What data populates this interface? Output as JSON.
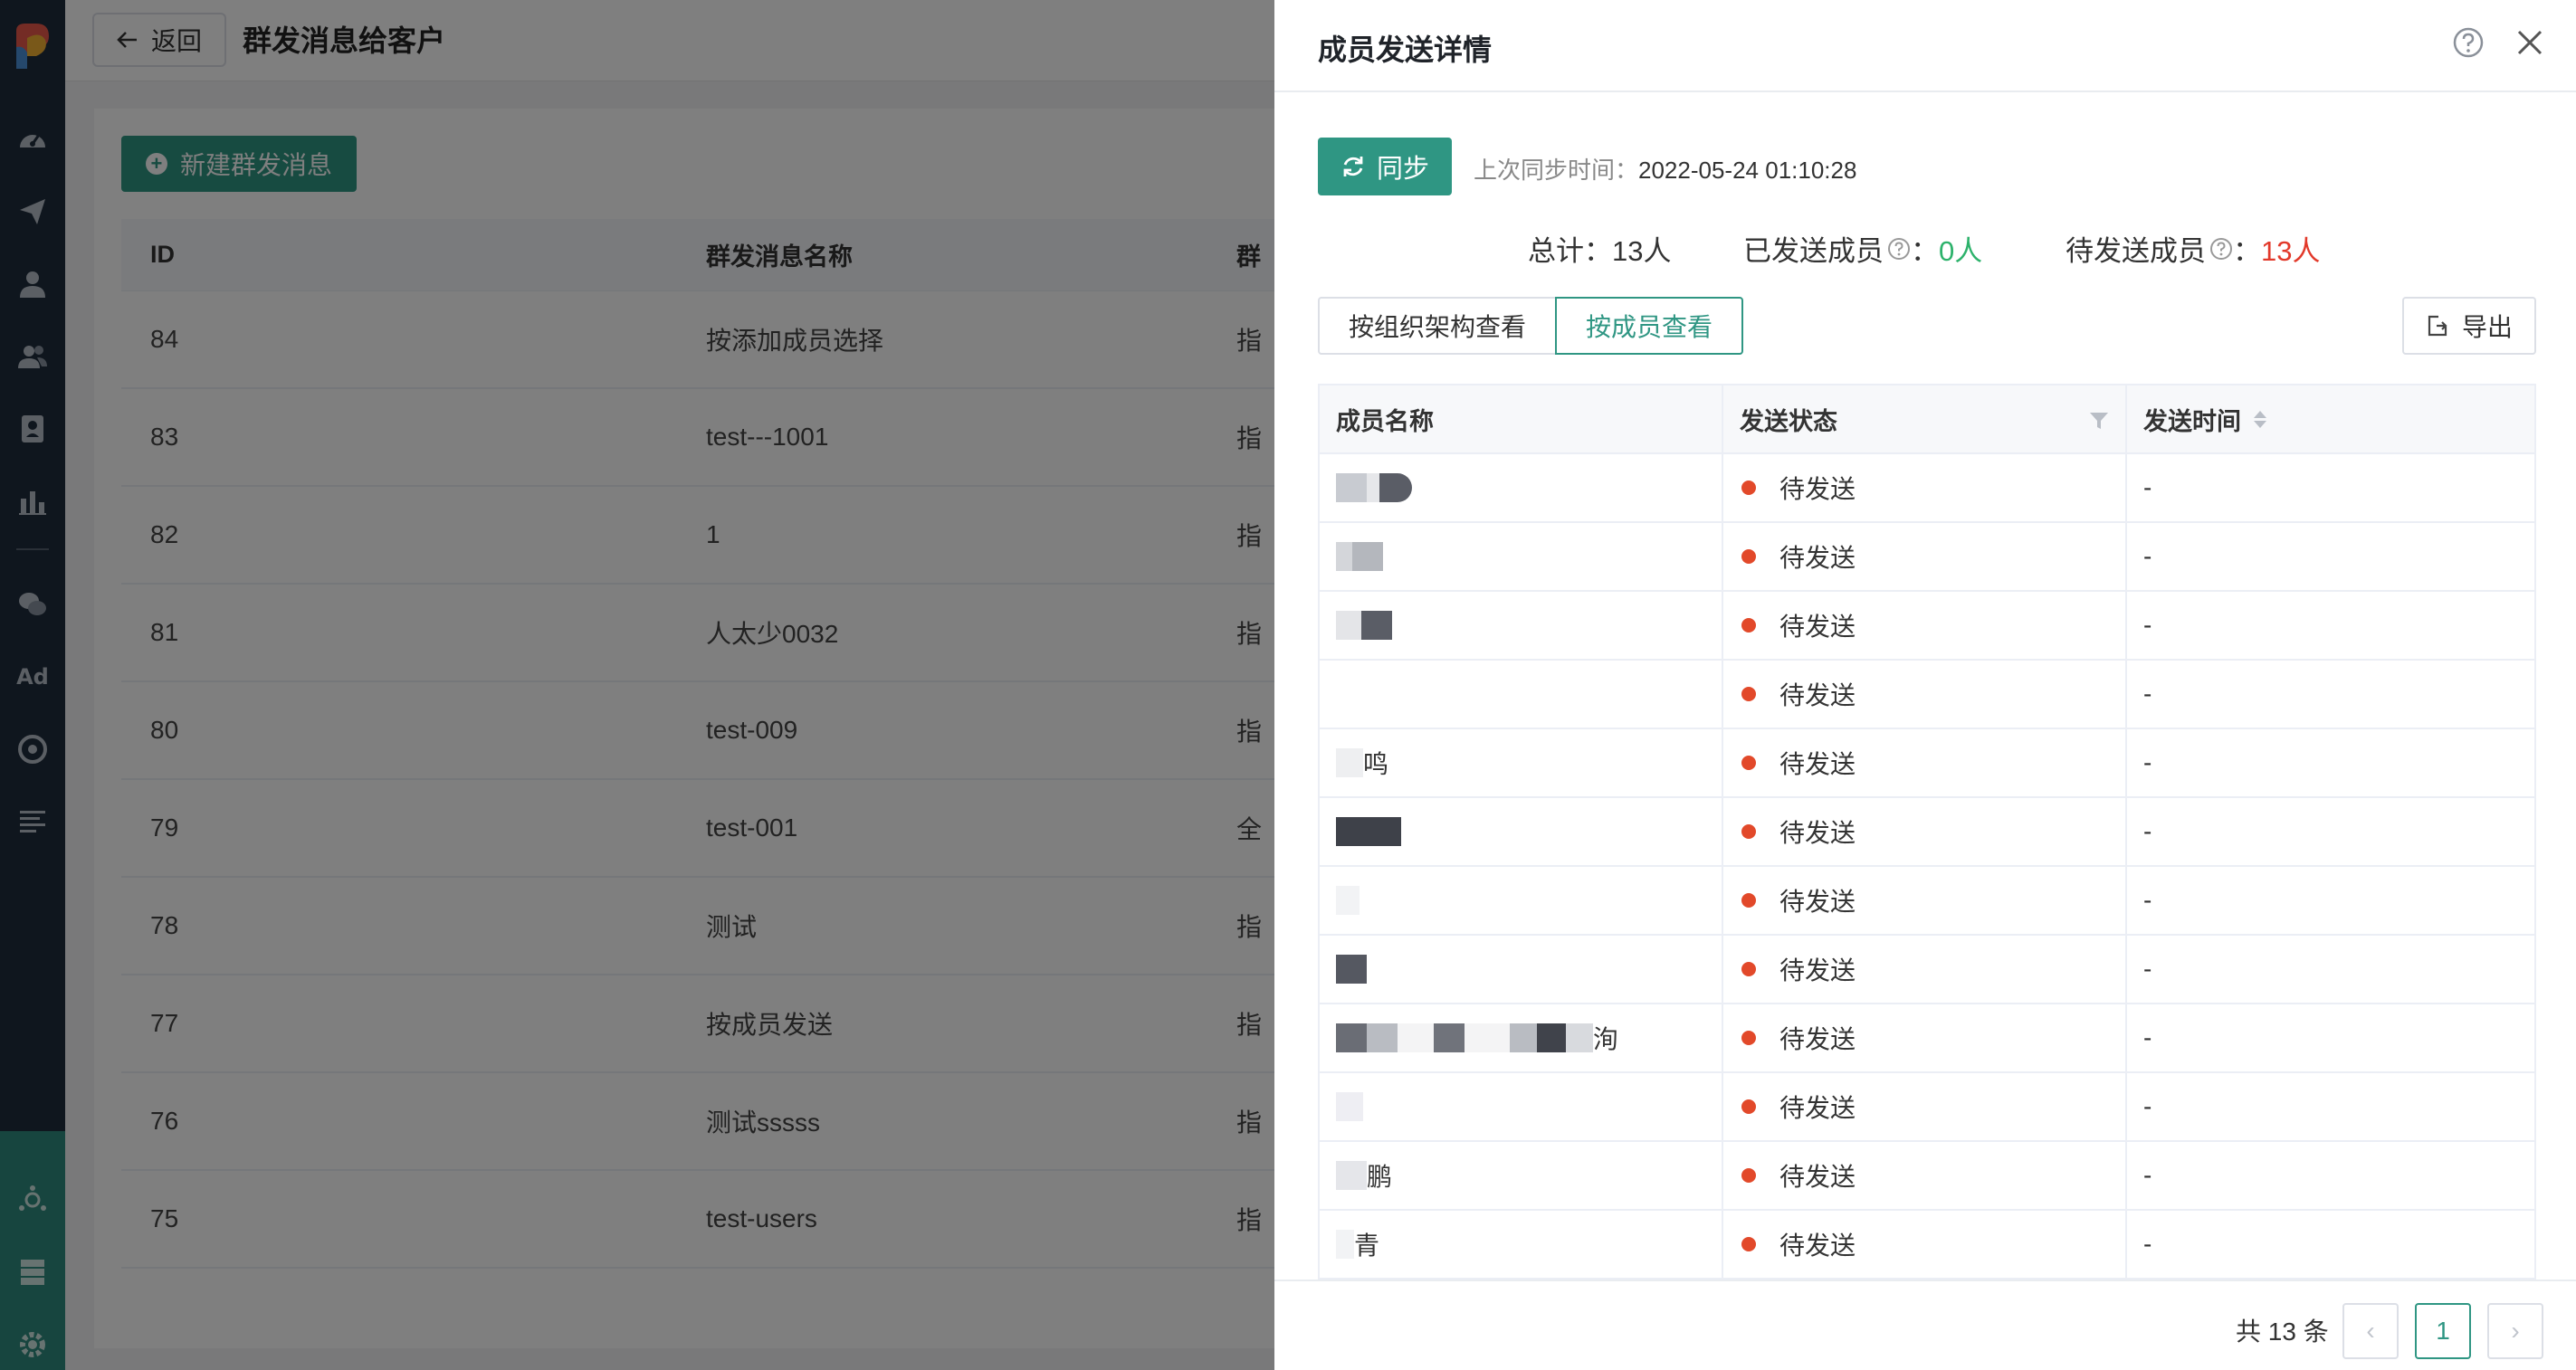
{
  "page": {
    "back_label": "返回",
    "title": "群发消息给客户",
    "new_button": "新建群发消息",
    "table": {
      "headers": [
        "ID",
        "群发消息名称",
        "群"
      ],
      "rows": [
        {
          "id": "84",
          "name": "按添加成员选择",
          "extra": "指"
        },
        {
          "id": "83",
          "name": "test---1001",
          "extra": "指"
        },
        {
          "id": "82",
          "name": "1",
          "extra": "指"
        },
        {
          "id": "81",
          "name": "人太少0032",
          "extra": "指"
        },
        {
          "id": "80",
          "name": "test-009",
          "extra": "指"
        },
        {
          "id": "79",
          "name": "test-001",
          "extra": "全"
        },
        {
          "id": "78",
          "name": "测试",
          "extra": "指"
        },
        {
          "id": "77",
          "name": "按成员发送",
          "extra": "指"
        },
        {
          "id": "76",
          "name": "测试sssss",
          "extra": "指"
        },
        {
          "id": "75",
          "name": "test-users",
          "extra": "指"
        }
      ]
    }
  },
  "sidebar": {
    "ad_label": "Ad",
    "icons": [
      "dashboard-icon",
      "send-icon",
      "user-icon",
      "users-icon",
      "contact-card-icon",
      "bar-chart-icon",
      "wechat-icon",
      "ad-icon",
      "target-icon",
      "list-icon",
      "network-icon",
      "server-icon",
      "settings-icon"
    ]
  },
  "drawer": {
    "title": "成员发送详情",
    "sync_button": "同步",
    "sync_time_label": "上次同步时间：",
    "sync_time_value": "2022-05-24 01:10:28",
    "stats": {
      "total_label": "总计：",
      "total_value": "13人",
      "sent_label": "已发送成员",
      "sent_value": "0人",
      "pending_label": "待发送成员",
      "pending_value": "13人",
      "colon": "："
    },
    "view_tabs": [
      "按组织架构查看",
      "按成员查看"
    ],
    "active_tab": "按成员查看",
    "export_button": "导出",
    "table": {
      "headers": [
        "成员名称",
        "发送状态",
        "发送时间"
      ],
      "rows": [
        {
          "name": "",
          "status": "待发送",
          "time": "-"
        },
        {
          "name": "",
          "status": "待发送",
          "time": "-"
        },
        {
          "name": "",
          "status": "待发送",
          "time": "-"
        },
        {
          "name": "",
          "status": "待发送",
          "time": "-"
        },
        {
          "name": "鸣",
          "status": "待发送",
          "time": "-"
        },
        {
          "name": "",
          "status": "待发送",
          "time": "-"
        },
        {
          "name": "",
          "status": "待发送",
          "time": "-"
        },
        {
          "name": "",
          "status": "待发送",
          "time": "-"
        },
        {
          "name": "洵",
          "status": "待发送",
          "time": "-"
        },
        {
          "name": "",
          "status": "待发送",
          "time": "-"
        },
        {
          "name": "鹏",
          "status": "待发送",
          "time": "-"
        },
        {
          "name": "青",
          "status": "待发送",
          "time": "-"
        }
      ]
    },
    "pagination": {
      "total_text": "共 13 条",
      "prev": "‹",
      "current_page": "1",
      "next": "›"
    }
  },
  "colors": {
    "accent": "#2f9683",
    "sent_green": "#2db26b",
    "pending_red": "#e2392a",
    "sidebar_bg": "#1f2d3d"
  }
}
